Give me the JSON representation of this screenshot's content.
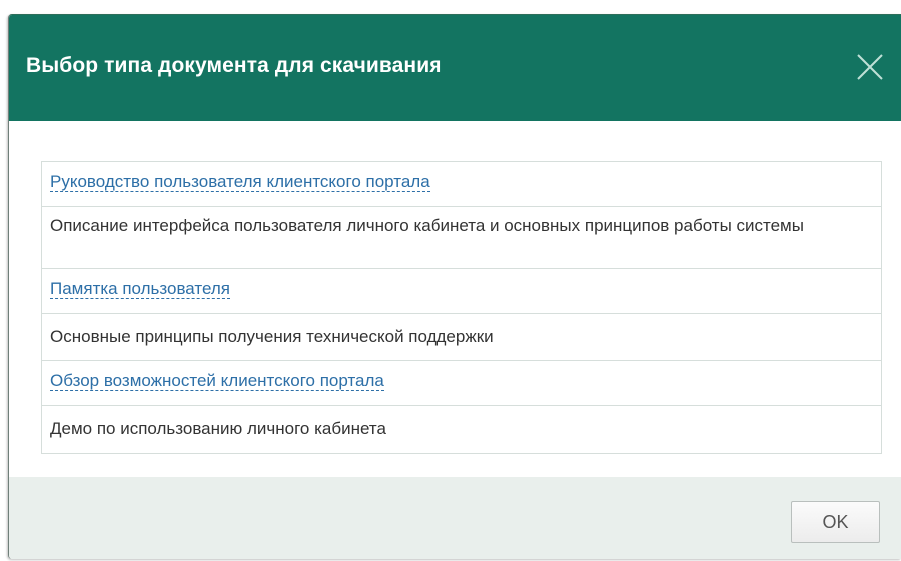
{
  "dialog": {
    "title": "Выбор типа документа для скачивания",
    "close_icon": "close-icon",
    "ok_label": "OK"
  },
  "documents": [
    {
      "link": "Руководство пользователя клиентского портала",
      "description": "Описание интерфейса пользователя личного кабинета и основных принципов работы системы"
    },
    {
      "link": "Памятка пользователя",
      "description": "Основные принципы получения технической поддержки"
    },
    {
      "link": "Обзор возможностей клиентского портала",
      "description": "Демо по использованию личного кабинета"
    }
  ],
  "colors": {
    "header": "#137461",
    "link": "#2d6fa7",
    "footer": "#e9efec"
  }
}
